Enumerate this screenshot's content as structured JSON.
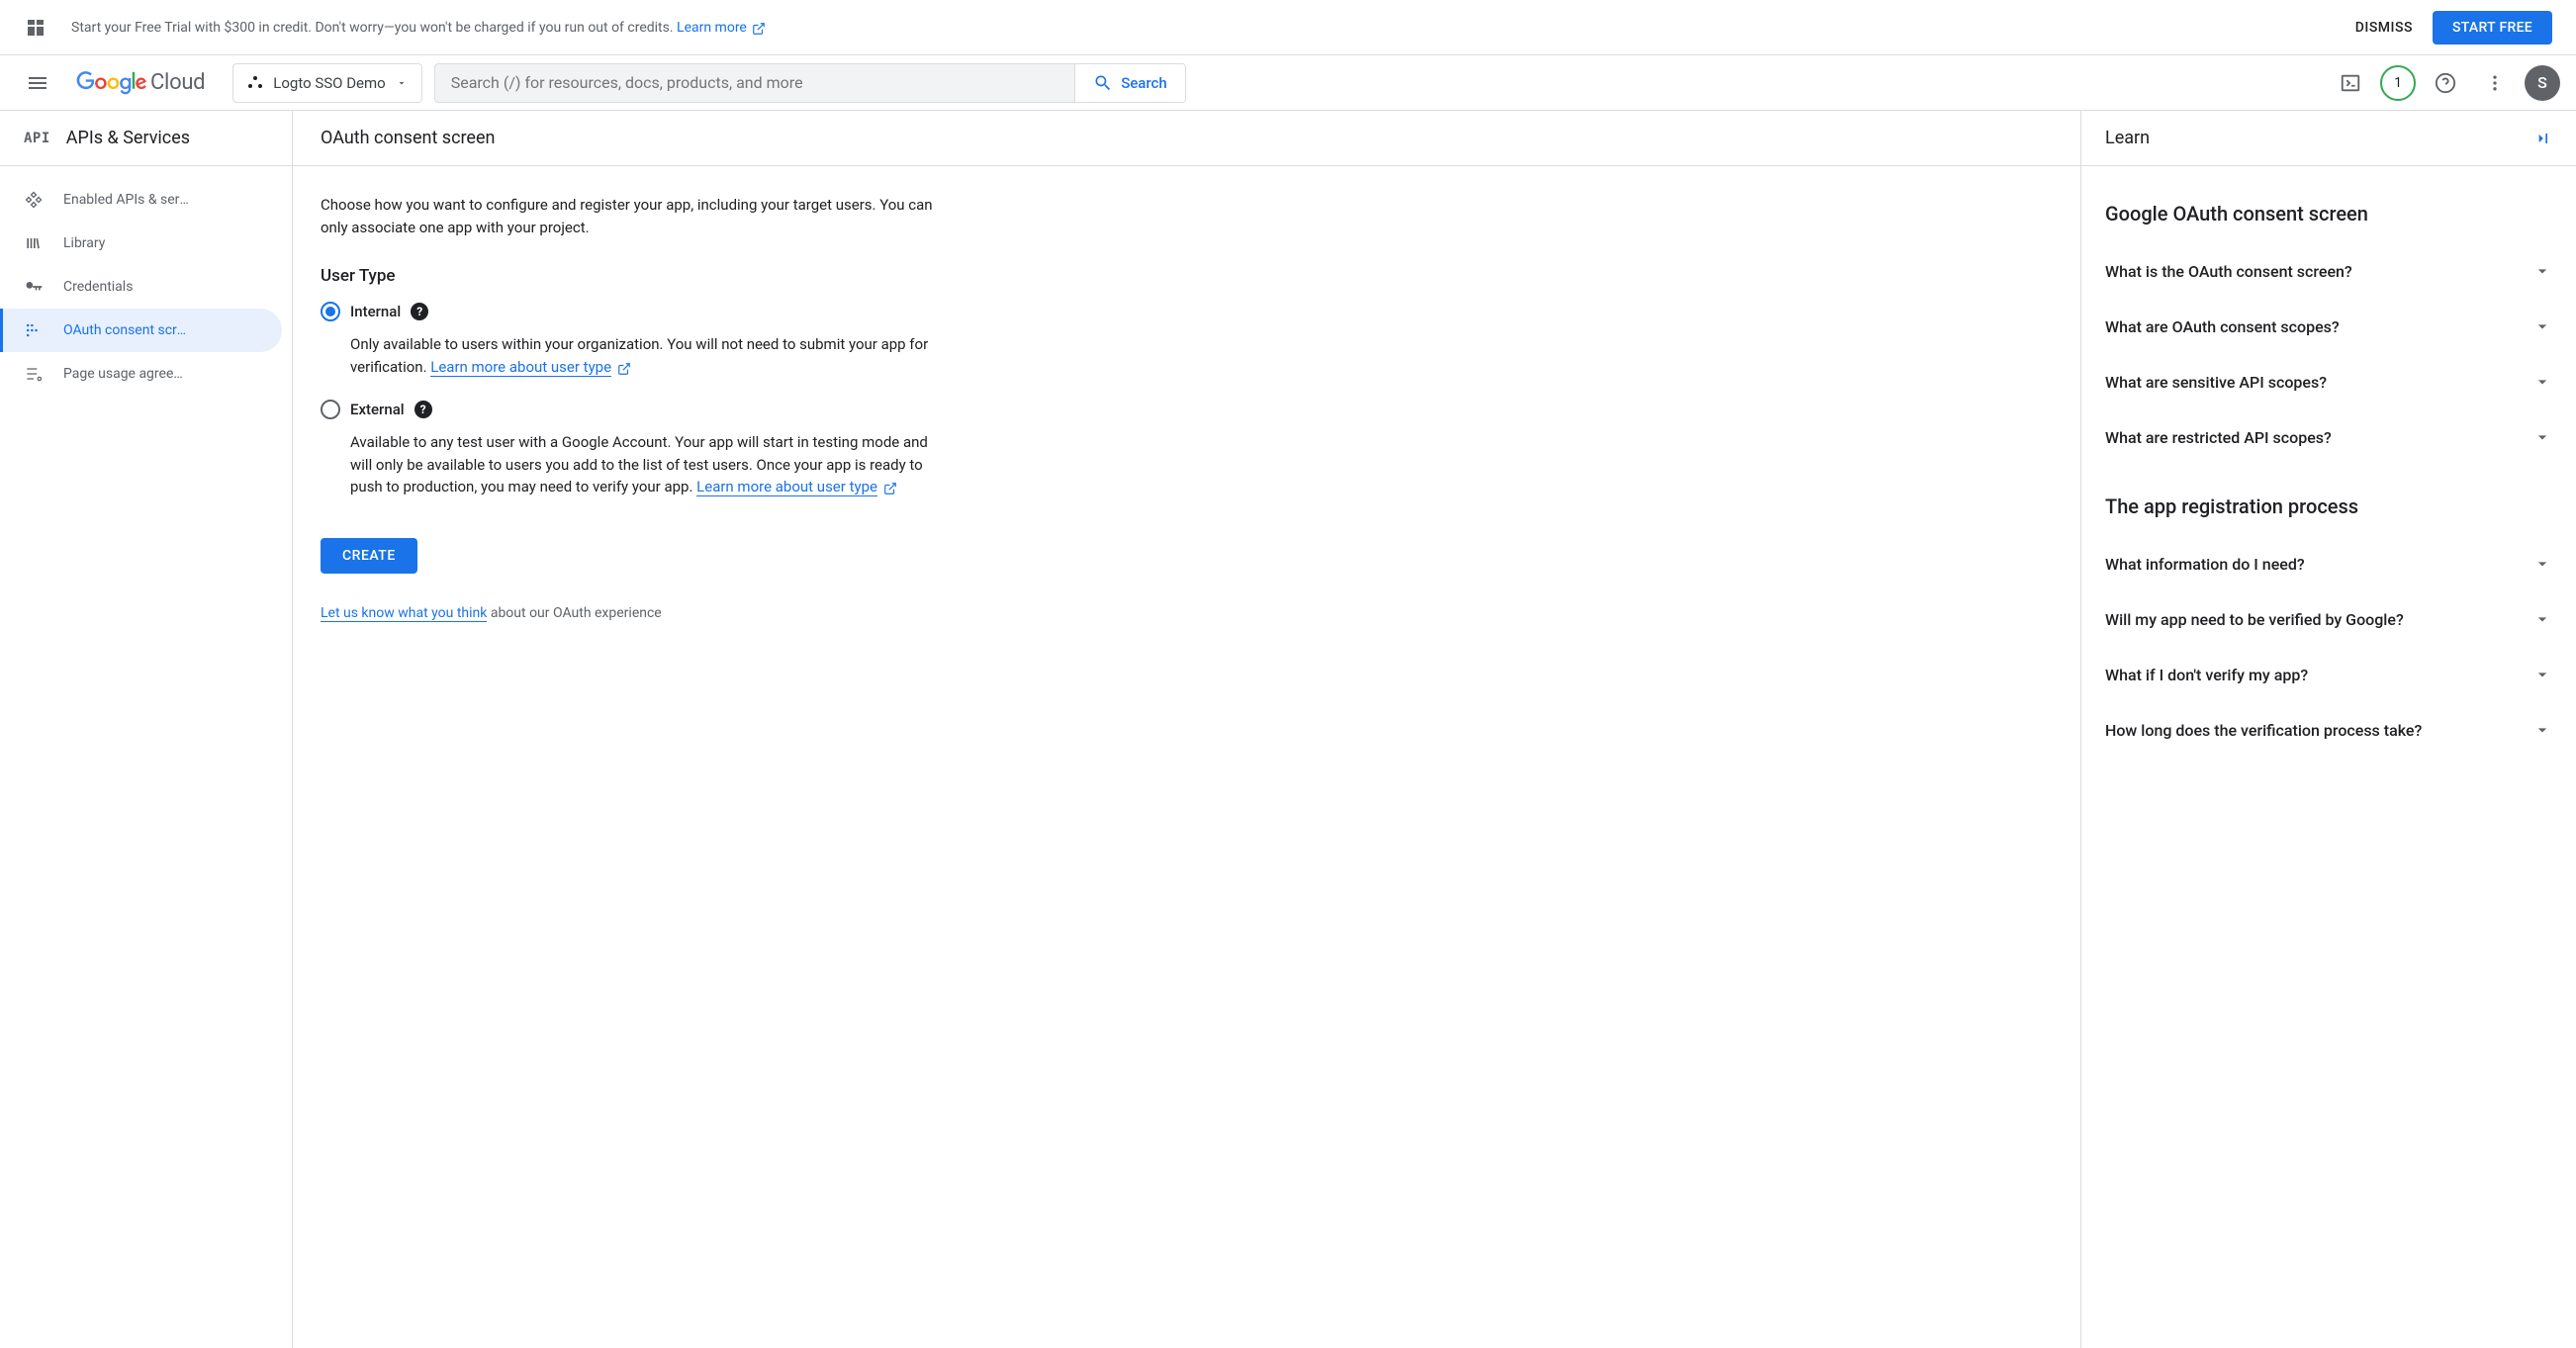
{
  "promo": {
    "text": "Start your Free Trial with $300 in credit. Don't worry—you won't be charged if you run out of credits. ",
    "link_text": "Learn more",
    "dismiss": "DISMISS",
    "start_free": "START FREE"
  },
  "nav": {
    "logo_cloud": "Cloud",
    "project_name": "Logto SSO Demo",
    "search_placeholder": "Search (/) for resources, docs, products, and more",
    "search_btn": "Search",
    "trial_count": "1",
    "avatar_letter": "S"
  },
  "sidebar": {
    "api_badge": "API",
    "title": "APIs & Services",
    "items": [
      {
        "label": "Enabled APIs & services",
        "icon": "diamond"
      },
      {
        "label": "Library",
        "icon": "library"
      },
      {
        "label": "Credentials",
        "icon": "key"
      },
      {
        "label": "OAuth consent screen",
        "icon": "consent"
      },
      {
        "label": "Page usage agreements",
        "icon": "agreement"
      }
    ]
  },
  "content": {
    "title": "OAuth consent screen",
    "intro": "Choose how you want to configure and register your app, including your target users. You can only associate one app with your project.",
    "user_type_heading": "User Type",
    "internal": {
      "label": "Internal",
      "desc": "Only available to users within your organization. You will not need to submit your app for verification. ",
      "link": "Learn more about user type"
    },
    "external": {
      "label": "External",
      "desc": "Available to any test user with a Google Account. Your app will start in testing mode and will only be available to users you add to the list of test users. Once your app is ready to push to production, you may need to verify your app. ",
      "link": "Learn more about user type"
    },
    "create_btn": "CREATE",
    "feedback_link": "Let us know what you think",
    "feedback_rest": " about our OAuth experience"
  },
  "learn": {
    "title": "Learn",
    "section1": "Google OAuth consent screen",
    "items1": [
      "What is the OAuth consent screen?",
      "What are OAuth consent scopes?",
      "What are sensitive API scopes?",
      "What are restricted API scopes?"
    ],
    "section2": "The app registration process",
    "items2": [
      "What information do I need?",
      "Will my app need to be verified by Google?",
      "What if I don't verify my app?",
      "How long does the verification process take?"
    ]
  }
}
